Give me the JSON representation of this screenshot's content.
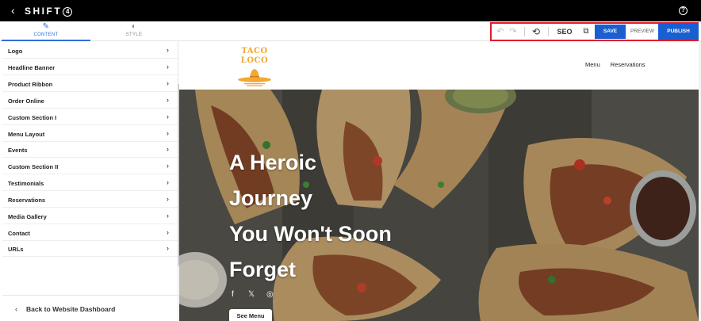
{
  "topbar": {
    "back_icon": "‹",
    "app_name": "SHIFT",
    "app_name_suffix": "4",
    "help_icon": "?"
  },
  "tabs": [
    {
      "label": "CONTENT",
      "icon": "pencil-icon",
      "active": true
    },
    {
      "label": "STYLE",
      "icon": "contrast-icon",
      "active": false
    }
  ],
  "actions": {
    "seo_label": "SEO",
    "save_label": "SAVE",
    "preview_label": "PREVIEW",
    "publish_label": "PUBLISH"
  },
  "sidebar": {
    "items": [
      {
        "label": "Logo"
      },
      {
        "label": "Headline Banner"
      },
      {
        "label": "Product Ribbon"
      },
      {
        "label": "Order Online"
      },
      {
        "label": "Custom Section I"
      },
      {
        "label": "Menu Layout"
      },
      {
        "label": "Events"
      },
      {
        "label": "Custom Section II"
      },
      {
        "label": "Testimonials"
      },
      {
        "label": "Reservations"
      },
      {
        "label": "Media Gallery"
      },
      {
        "label": "Contact"
      },
      {
        "label": "URLs"
      }
    ],
    "footer_label": "Back to Website Dashboard"
  },
  "site": {
    "brand": "TACO LOCO",
    "nav": [
      "Menu",
      "Reservations"
    ],
    "headline_lines": [
      "A Heroic",
      "Journey",
      "You Won't Soon",
      "Forget"
    ],
    "cta_label": "See Menu",
    "socials": [
      "facebook-icon",
      "x-icon",
      "instagram-icon"
    ]
  },
  "colors": {
    "accent": "#1a5fd0",
    "highlight_border": "#e11b2c",
    "brand": "#f2a832"
  }
}
